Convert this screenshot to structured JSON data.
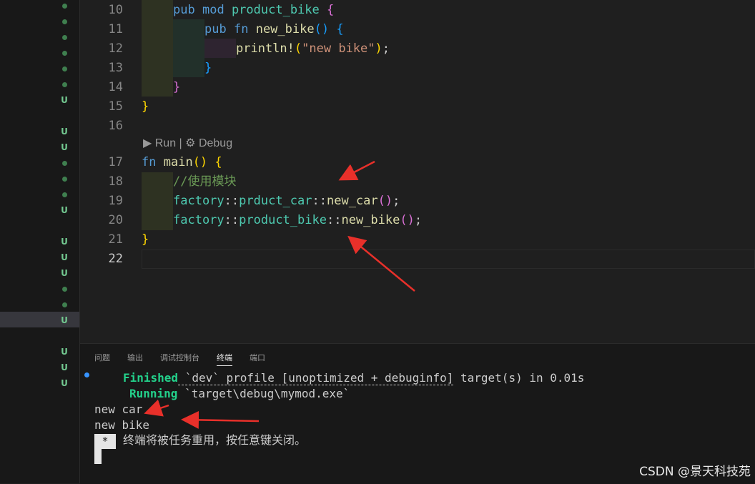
{
  "editor": {
    "lines": [
      {
        "n": "10"
      },
      {
        "n": "11"
      },
      {
        "n": "12"
      },
      {
        "n": "13"
      },
      {
        "n": "14"
      },
      {
        "n": "15"
      },
      {
        "n": "16"
      },
      {
        "n": "17"
      },
      {
        "n": "18"
      },
      {
        "n": "19"
      },
      {
        "n": "20"
      },
      {
        "n": "21"
      },
      {
        "n": "22"
      }
    ],
    "codelens": "▶ Run | ⚙ Debug",
    "tokens": {
      "pub": "pub",
      "mod": "mod",
      "product_bike": "product_bike",
      "fn": "fn",
      "new_bike": "new_bike",
      "println": "println!",
      "new_bike_str": "\"new bike\"",
      "main": "main",
      "comment": "//使用模块",
      "factory": "factory",
      "prduct_car": "prduct_car",
      "new_car": "new_car"
    }
  },
  "sidebar": {
    "markers": [
      "dot",
      "dot",
      "dot",
      "dot",
      "dot",
      "dot",
      "U",
      "",
      "U",
      "U",
      "dot",
      "dot",
      "dot",
      "U",
      "",
      "U",
      "U",
      "U",
      "dot",
      "dot",
      "U",
      "",
      "U",
      "U",
      "U"
    ]
  },
  "panel": {
    "tabs": [
      "问题",
      "输出",
      "调试控制台",
      "终端",
      "端口"
    ],
    "active_tab": "终端",
    "terminal": {
      "finished_word": "Finished",
      "finished_rest_1": " `dev` profile [unoptimized + debuginfo]",
      "finished_rest_2": " target(s) in 0.01s",
      "running_word": "Running",
      "running_rest": " `target\\debug\\mymod.exe`",
      "out1": "new car",
      "out2": "new bike",
      "cursor_char": "*",
      "close_msg": "终端将被任务重用，按任意键关闭。"
    }
  },
  "watermark": "CSDN @景天科技苑",
  "colors": {
    "accent_arrow": "#e8302a",
    "terminal_green": "#23d18b"
  }
}
